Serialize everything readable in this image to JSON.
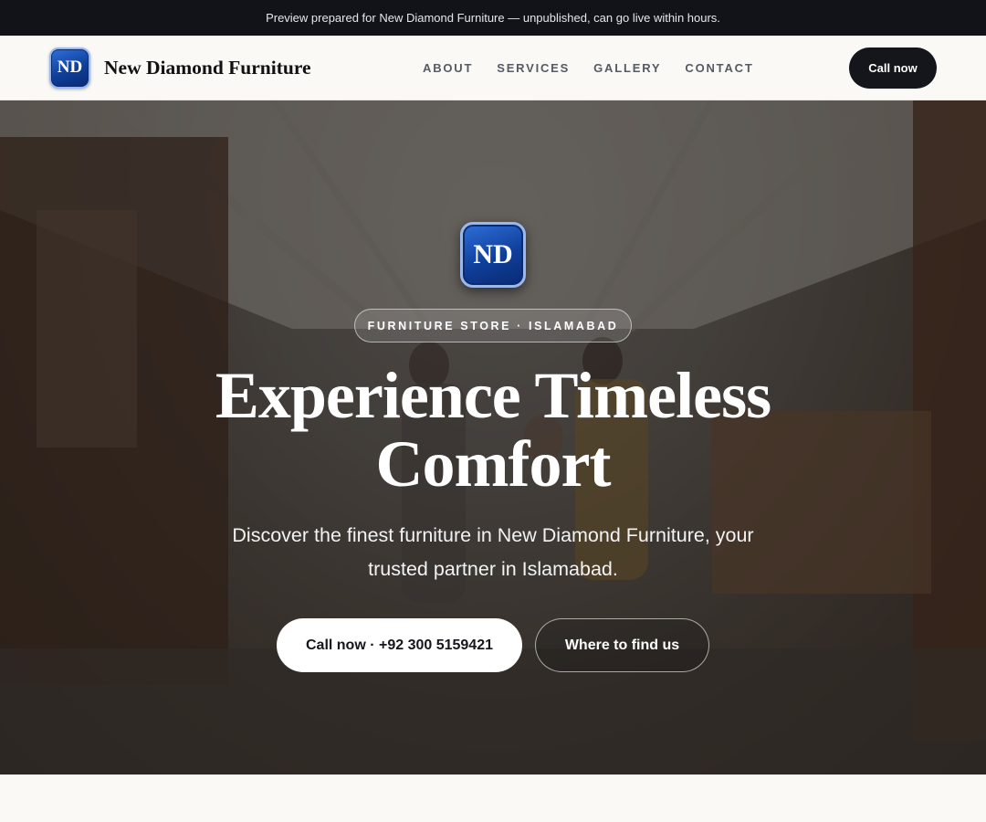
{
  "preview_bar": {
    "text": "Preview prepared for New Diamond Furniture — unpublished, can go live within hours."
  },
  "header": {
    "logo_text": "ND",
    "brand_name": "New Diamond Furniture",
    "nav": [
      {
        "label": "ABOUT"
      },
      {
        "label": "SERVICES"
      },
      {
        "label": "GALLERY"
      },
      {
        "label": "CONTACT"
      }
    ],
    "cta_label": "Call now"
  },
  "hero": {
    "logo_text": "ND",
    "tag": "FURNITURE STORE · ISLAMABAD",
    "title_line1": "Experience Timeless",
    "title_line2": "Comfort",
    "subtitle": "Discover the finest furniture in New Diamond Furniture, your trusted partner in Islamabad.",
    "primary_button": "Call now · +92 300 5159421",
    "secondary_button": "Where to find us",
    "background_image": "furniture-showroom-photo"
  },
  "colors": {
    "dark": "#14161b",
    "logo_blue": "#0f3f9b",
    "page_bg": "#faf9f6"
  }
}
